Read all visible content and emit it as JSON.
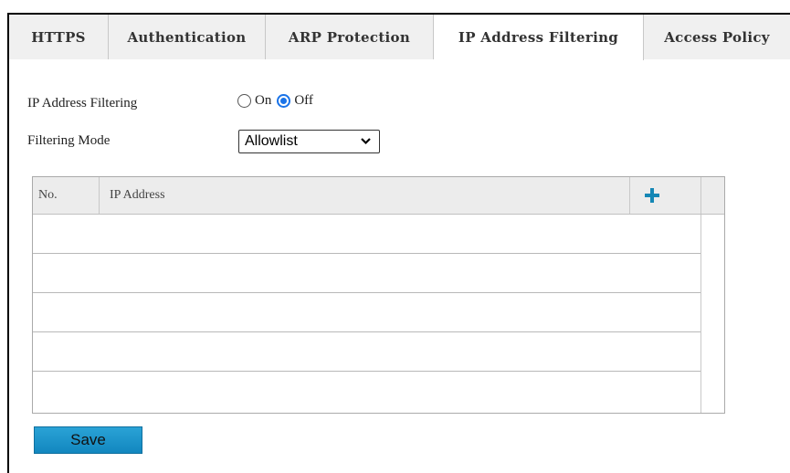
{
  "tabs": [
    {
      "label": "HTTPS",
      "active": false
    },
    {
      "label": "Authentication",
      "active": false
    },
    {
      "label": "ARP Protection",
      "active": false
    },
    {
      "label": "IP Address Filtering",
      "active": true
    },
    {
      "label": "Access Policy",
      "active": false
    }
  ],
  "form": {
    "filtering_label": "IP Address Filtering",
    "radio_on_label": "On",
    "radio_off_label": "Off",
    "selected_option": "Off",
    "mode_label": "Filtering Mode",
    "mode_value": "Allowlist"
  },
  "table": {
    "headers": {
      "no": "No.",
      "ip": "IP Address"
    },
    "add_icon": "plus-icon",
    "rows": []
  },
  "actions": {
    "save_label": "Save"
  },
  "colors": {
    "accent": "#1a73e8",
    "save_button": "#1a93c9",
    "add_icon": "#1587b5"
  }
}
